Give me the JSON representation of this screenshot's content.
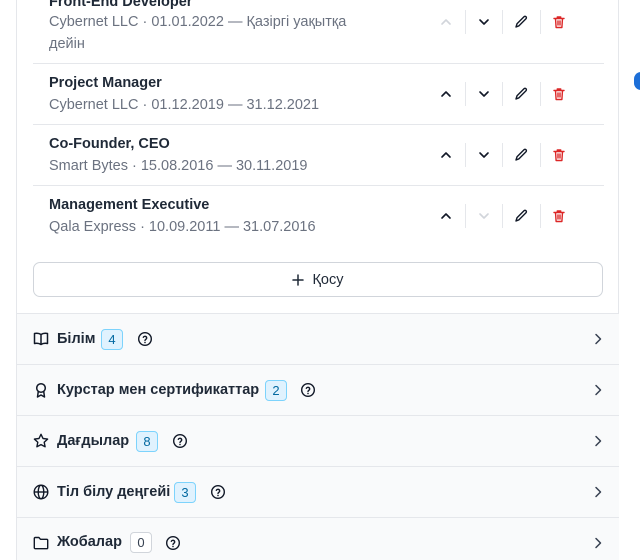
{
  "experience": [
    {
      "title": "Front-End Developer",
      "meta_line1": "Cybernet LLC · 01.01.2022 — Қазіргі уақытқа",
      "meta_line2": "дейін"
    },
    {
      "title": "Project Manager",
      "meta_line1": "Cybernet LLC · 01.12.2019 — 31.12.2021"
    },
    {
      "title": "Co-Founder, CEO",
      "meta_line1": "Smart Bytes · 15.08.2016 — 30.11.2019"
    },
    {
      "title": "Management Executive",
      "meta_line1": "Qala Express · 10.09.2011 — 31.07.2016"
    }
  ],
  "add_button": {
    "label": "Қосу",
    "icon": "plus-icon"
  },
  "sections": [
    {
      "title": "Білім",
      "count": "4",
      "icon": "book-icon",
      "badge_style": "blue"
    },
    {
      "title": "Курстар мен сертификаттар",
      "count": "2",
      "icon": "award-icon",
      "badge_style": "blue"
    },
    {
      "title": "Дағдылар",
      "count": "8",
      "icon": "star-icon",
      "badge_style": "blue"
    },
    {
      "title": "Тіл білу деңгейі",
      "count": "3",
      "icon": "globe-icon",
      "badge_style": "blue"
    },
    {
      "title": "Жобалар",
      "count": "0",
      "icon": "folder-icon",
      "badge_style": "gray"
    }
  ],
  "colors": {
    "delete": "#dc2626",
    "badge_blue_bg": "#e0f2fe",
    "badge_blue_border": "#7dd3fc",
    "accent": "#1d6fd8"
  }
}
